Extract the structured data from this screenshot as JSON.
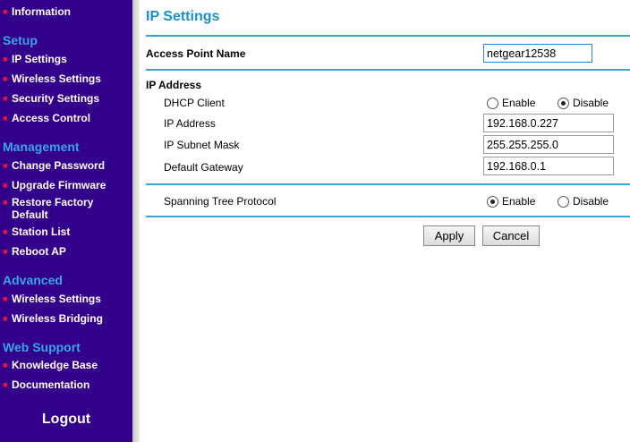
{
  "sidebar": {
    "items": [
      {
        "label": "Information"
      },
      {
        "label": "IP Settings"
      },
      {
        "label": "Wireless Settings"
      },
      {
        "label": "Security Settings"
      },
      {
        "label": "Access Control"
      },
      {
        "label": "Change Password"
      },
      {
        "label": "Upgrade Firmware"
      },
      {
        "label": "Restore Factory Default"
      },
      {
        "label": "Station List"
      },
      {
        "label": "Reboot AP"
      },
      {
        "label": "Wireless Settings"
      },
      {
        "label": "Wireless Bridging"
      },
      {
        "label": "Knowledge Base"
      },
      {
        "label": "Documentation"
      }
    ],
    "sections": {
      "setup": "Setup",
      "management": "Management",
      "advanced": "Advanced",
      "web_support": "Web Support"
    },
    "logout_label": "Logout"
  },
  "main": {
    "title": "IP Settings",
    "access_point_name": {
      "label": "Access Point Name",
      "value": "netgear12538"
    },
    "ip_address_section": {
      "heading": "IP Address",
      "dhcp_client": {
        "label": "DHCP Client",
        "enable_label": "Enable",
        "disable_label": "Disable",
        "selected": "Disable"
      },
      "ip_address": {
        "label": "IP Address",
        "value": "192.168.0.227"
      },
      "subnet_mask": {
        "label": "IP Subnet Mask",
        "value": "255.255.255.0"
      },
      "default_gateway": {
        "label": "Default Gateway",
        "value": "192.168.0.1"
      }
    },
    "spanning_tree": {
      "label": "Spanning Tree Protocol",
      "enable_label": "Enable",
      "disable_label": "Disable",
      "selected": "Enable"
    },
    "buttons": {
      "apply_label": "Apply",
      "cancel_label": "Cancel"
    }
  },
  "colors": {
    "sidebar_background": "#33008c",
    "sidebar_section_text": "#37a7e8",
    "sidebar_bullet": "#e8143c",
    "title_text": "#1891c8",
    "divider_line": "#3aa3d3"
  }
}
